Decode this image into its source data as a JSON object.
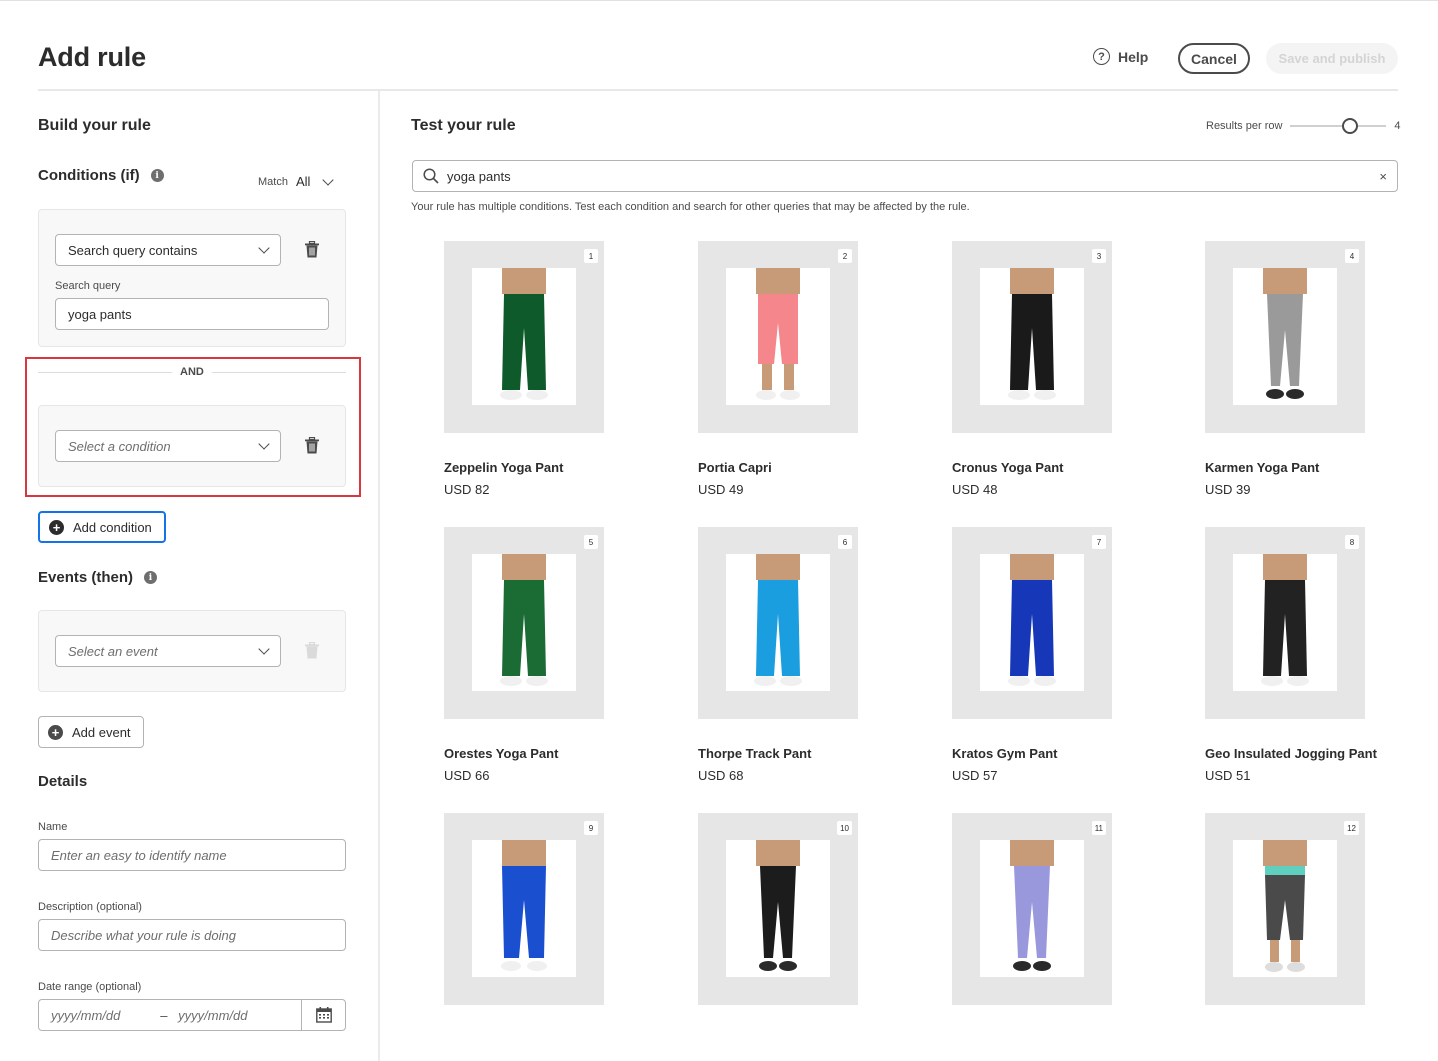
{
  "header": {
    "title": "Add rule",
    "help_label": "Help",
    "help_glyph": "?",
    "cancel_label": "Cancel",
    "save_label": "Save and publish"
  },
  "build": {
    "title": "Build your rule",
    "conditions": {
      "title": "Conditions (if)",
      "match_label": "Match",
      "match_value": "All",
      "condition1": {
        "select_value": "Search query contains",
        "field_label": "Search query",
        "field_value": "yoga pants"
      },
      "operator": "AND",
      "condition2": {
        "placeholder": "Select a condition"
      },
      "add_label": "Add condition"
    },
    "events": {
      "title": "Events (then)",
      "placeholder": "Select an event",
      "add_label": "Add event"
    },
    "details": {
      "title": "Details",
      "name_label": "Name",
      "name_placeholder": "Enter an easy to identify name",
      "desc_label": "Description (optional)",
      "desc_placeholder": "Describe what your rule is doing",
      "date_label": "Date range (optional)",
      "date_start_placeholder": "yyyy/mm/dd",
      "date_sep": "–",
      "date_end_placeholder": "yyyy/mm/dd"
    }
  },
  "test": {
    "title": "Test your rule",
    "results_per_row_label": "Results per row",
    "results_per_row_value": "4",
    "search_value": "yoga pants",
    "clear_glyph": "×",
    "hint": "Your rule has multiple conditions. Test each condition and search for other queries that may be affected by the rule.",
    "products": [
      {
        "rank": "1",
        "name": "Zeppelin Yoga Pant",
        "price": "USD 82",
        "pant_color": "#0f5a2a",
        "style": "straight"
      },
      {
        "rank": "2",
        "name": "Portia Capri",
        "price": "USD 49",
        "pant_color": "#f4868c",
        "style": "capri"
      },
      {
        "rank": "3",
        "name": "Cronus Yoga Pant",
        "price": "USD 48",
        "pant_color": "#1a1a1a",
        "style": "straight"
      },
      {
        "rank": "4",
        "name": "Karmen Yoga Pant",
        "price": "USD 39",
        "pant_color": "#9a9a9a",
        "style": "legging"
      },
      {
        "rank": "5",
        "name": "Orestes Yoga Pant",
        "price": "USD 66",
        "pant_color": "#1b6b35",
        "style": "straight"
      },
      {
        "rank": "6",
        "name": "Thorpe Track Pant",
        "price": "USD 68",
        "pant_color": "#1a9ee0",
        "style": "straight"
      },
      {
        "rank": "7",
        "name": "Kratos Gym Pant",
        "price": "USD 57",
        "pant_color": "#1638b8",
        "style": "straight"
      },
      {
        "rank": "8",
        "name": "Geo Insulated Jogging Pant",
        "price": "USD 51",
        "pant_color": "#222222",
        "style": "straight"
      },
      {
        "rank": "9",
        "name": "",
        "price": "",
        "pant_color": "#1a4fd0",
        "style": "jogger"
      },
      {
        "rank": "10",
        "name": "",
        "price": "",
        "pant_color": "#1c1c1c",
        "style": "legging"
      },
      {
        "rank": "11",
        "name": "",
        "price": "",
        "pant_color": "#9a98dc",
        "style": "legging"
      },
      {
        "rank": "12",
        "name": "",
        "price": "",
        "pant_color": "#4a4a4a",
        "style": "capri-band"
      }
    ]
  }
}
